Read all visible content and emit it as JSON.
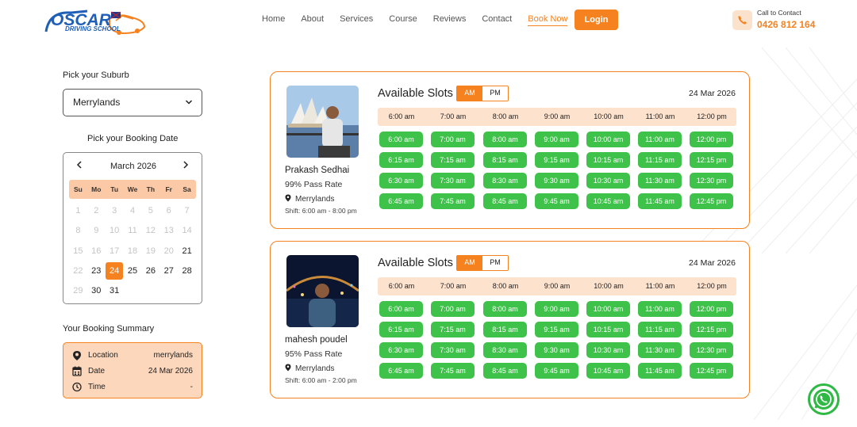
{
  "header": {
    "logo_line1": "OSCAR",
    "logo_line2": "DRIVING SCHOOL",
    "nav": [
      "Home",
      "About",
      "Services",
      "Course",
      "Reviews",
      "Contact",
      "Book Now"
    ],
    "active_nav": "Book Now",
    "login_label": "Login",
    "contact_label": "Call to Contact",
    "contact_phone": "0426 812 164"
  },
  "sidebar": {
    "suburb_title": "Pick your Suburb",
    "suburb_value": "Merrylands",
    "date_title": "Pick your Booking Date",
    "calendar": {
      "month_label": "March 2026",
      "weekdays": [
        "Su",
        "Mo",
        "Tu",
        "We",
        "Th",
        "Fr",
        "Sa"
      ],
      "weeks": [
        [
          "1",
          "2",
          "3",
          "4",
          "5",
          "6",
          "7"
        ],
        [
          "8",
          "9",
          "10",
          "11",
          "12",
          "13",
          "14"
        ],
        [
          "15",
          "16",
          "17",
          "18",
          "19",
          "20",
          "21"
        ],
        [
          "22",
          "23",
          "24",
          "25",
          "26",
          "27",
          "28"
        ],
        [
          "29",
          "30",
          "31",
          "",
          "",
          "",
          ""
        ]
      ],
      "enabled": [
        "21",
        "23",
        "24",
        "25",
        "26",
        "27",
        "28",
        "30",
        "31"
      ],
      "selected": "24"
    },
    "summary_title": "Your Booking Summary",
    "summary": {
      "location_label": "Location",
      "location_value": "merrylands",
      "date_label": "Date",
      "date_value": "24 Mar 2026",
      "time_label": "Time",
      "time_value": "-"
    }
  },
  "instructors": [
    {
      "name": "Prakash Sedhai",
      "pass_rate": "99% Pass Rate",
      "location": "Merrylands",
      "shift": "Shift: 6:00 am - 8:00 pm",
      "slots_title": "Available Slots",
      "am_label": "AM",
      "pm_label": "PM",
      "date": "24 Mar 2026"
    },
    {
      "name": "mahesh poudel",
      "pass_rate": "95% Pass Rate",
      "location": "Merrylands",
      "shift": "Shift: 6:00 am - 2:00 pm",
      "slots_title": "Available Slots",
      "am_label": "AM",
      "pm_label": "PM",
      "date": "24 Mar 2026"
    }
  ],
  "hours": [
    "6:00 am",
    "7:00 am",
    "8:00 am",
    "9:00 am",
    "10:00 am",
    "11:00 am",
    "12:00 pm"
  ],
  "slot_grid": [
    [
      "6:00 am",
      "7:00 am",
      "8:00 am",
      "9:00 am",
      "10:00 am",
      "11:00 am",
      "12:00 pm"
    ],
    [
      "6:15 am",
      "7:15 am",
      "8:15 am",
      "9:15 am",
      "10:15 am",
      "11:15 am",
      "12:15 pm"
    ],
    [
      "6:30 am",
      "7:30 am",
      "8:30 am",
      "9:30 am",
      "10:30 am",
      "11:30 am",
      "12:30 pm"
    ],
    [
      "6:45 am",
      "7:45 am",
      "8:45 am",
      "9:45 am",
      "10:45 am",
      "11:45 am",
      "12:45 pm"
    ]
  ],
  "colors": {
    "accent": "#f5821f",
    "slot_green": "#3ec24a",
    "brand_blue": "#1f5fb8",
    "whatsapp": "#2fb844"
  }
}
